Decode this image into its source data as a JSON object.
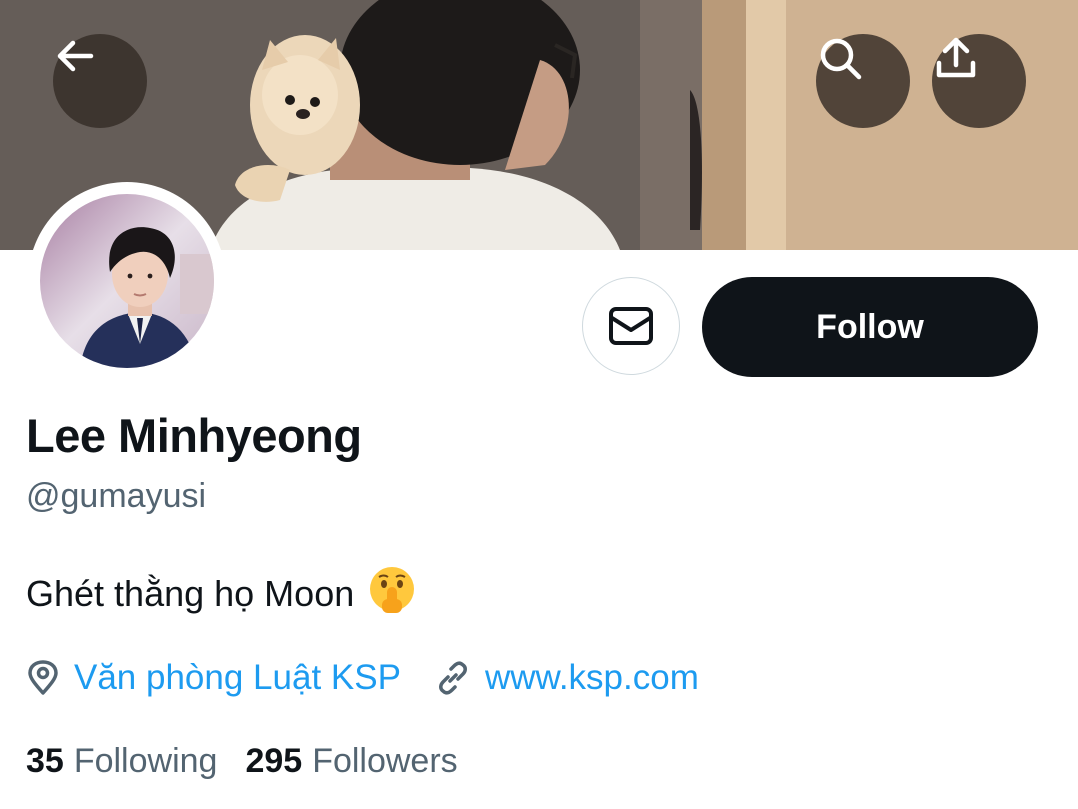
{
  "profile": {
    "display_name": "Lee Minhyeong",
    "handle": "@gumayusi",
    "bio": "Ghét thằng họ Moon",
    "bio_emoji": "shushing-face-emoji",
    "location": "Văn phòng Luật KSP",
    "website": "www.ksp.com",
    "following_count": "35",
    "following_label": "Following",
    "followers_count": "295",
    "followers_label": "Followers"
  },
  "actions": {
    "follow_label": "Follow"
  },
  "icons": {
    "back": "arrow-left-icon",
    "search": "search-icon",
    "share": "share-upload-icon",
    "message": "envelope-icon",
    "location": "location-pin-icon",
    "link": "link-icon"
  },
  "colors": {
    "accent_link": "#1d9bf0",
    "follow_button_bg": "#0f1419",
    "secondary_text": "#536471",
    "primary_text": "#0f1419",
    "banner_overlay_button": "#342c26"
  }
}
